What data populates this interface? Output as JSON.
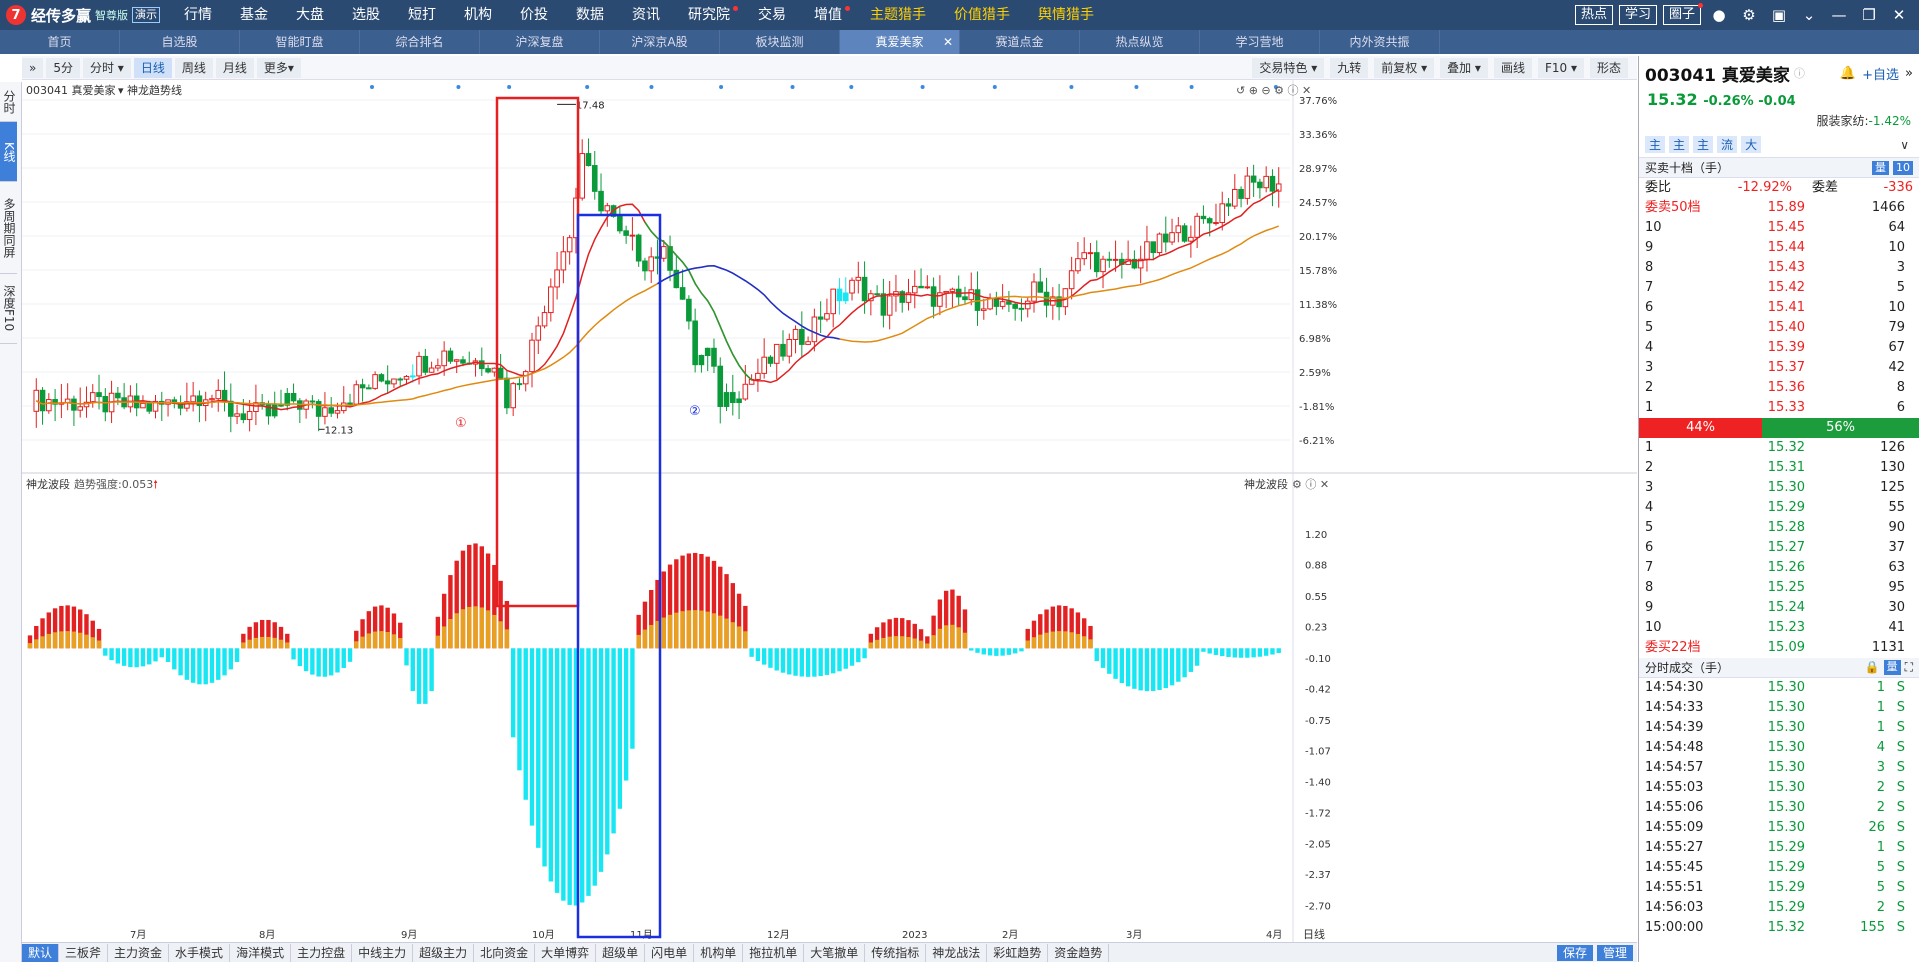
{
  "app": {
    "logo_mark": "7",
    "name": "经传多赢",
    "edition": "智尊版",
    "demo": "演示"
  },
  "topmenu": [
    {
      "label": "行情"
    },
    {
      "label": "基金"
    },
    {
      "label": "大盘"
    },
    {
      "label": "选股"
    },
    {
      "label": "短打"
    },
    {
      "label": "机构"
    },
    {
      "label": "价投"
    },
    {
      "label": "数据"
    },
    {
      "label": "资讯"
    },
    {
      "label": "研究院",
      "dot": true
    },
    {
      "label": "交易"
    },
    {
      "label": "增值",
      "dot": true
    },
    {
      "label": "主题猎手",
      "hl": true
    },
    {
      "label": "价值猎手",
      "hl": true
    },
    {
      "label": "舆情猎手",
      "hl": true
    }
  ],
  "topright": [
    {
      "label": "热点"
    },
    {
      "label": "学习"
    },
    {
      "label": "圈子",
      "dot": true
    }
  ],
  "tabs": [
    {
      "label": "首页"
    },
    {
      "label": "自选股"
    },
    {
      "label": "智能盯盘"
    },
    {
      "label": "综合排名"
    },
    {
      "label": "沪深复盘"
    },
    {
      "label": "沪深京A股"
    },
    {
      "label": "板块监测"
    },
    {
      "label": "真爱美家",
      "active": true
    },
    {
      "label": "赛道点金"
    },
    {
      "label": "热点纵览"
    },
    {
      "label": "学习营地"
    },
    {
      "label": "内外资共振"
    }
  ],
  "leftstrip": [
    {
      "label": "分时"
    },
    {
      "label": "K线",
      "active": true
    },
    {
      "label": "多周期同屏"
    },
    {
      "label": "深度F10"
    }
  ],
  "chart_toolbar": {
    "left": [
      {
        "label": "5分"
      },
      {
        "label": "分时 ▾"
      },
      {
        "label": "日线",
        "active": true
      },
      {
        "label": "周线"
      },
      {
        "label": "月线"
      },
      {
        "label": "更多▾"
      }
    ],
    "right": [
      {
        "label": "交易特色 ▾"
      },
      {
        "label": "九转"
      },
      {
        "label": "前复权 ▾"
      },
      {
        "label": "叠加 ▾"
      },
      {
        "label": "画线"
      },
      {
        "label": "F10 ▾"
      },
      {
        "label": "形态"
      }
    ]
  },
  "chart_header": {
    "stock": "003041 真爱美家",
    "indicator": "神龙趋势线"
  },
  "lower_header": {
    "indicator": "神龙波段",
    "strength": "趋势强度:0.053",
    "right_label": "神龙波段"
  },
  "chart_data": [
    {
      "type": "candlestick",
      "title": "",
      "y_ticks_pct": [
        "37.76%",
        "33.36%",
        "28.97%",
        "24.57%",
        "20.17%",
        "15.78%",
        "11.38%",
        "6.98%",
        "2.59%",
        "-1.81%",
        "-6.21%"
      ],
      "x_ticks": [
        "7月",
        "8月",
        "9月",
        "10月",
        "11月",
        "12月",
        "2023",
        "2月",
        "3月",
        "4月"
      ],
      "annotations": [
        {
          "text": "17.48"
        },
        {
          "text": "12.13"
        },
        {
          "text": "①"
        },
        {
          "text": "②"
        }
      ],
      "series": [
        {
          "name": "",
          "values": []
        }
      ]
    },
    {
      "type": "bar",
      "title": "",
      "y_ticks": [
        "1.20",
        "0.88",
        "0.55",
        "0.23",
        "-0.10",
        "-0.42",
        "-0.75",
        "-1.07",
        "-1.40",
        "-1.72",
        "-2.05",
        "-2.37",
        "-2.70"
      ],
      "ylim": [
        -2.85,
        1.45
      ]
    }
  ],
  "quote": {
    "code_name": "003041 真爱美家",
    "price": "15.32",
    "change": "-0.26% -0.04",
    "industry_label": "服装家纺:",
    "industry_value": "-1.42%",
    "add_watch": "自选"
  },
  "quote_btns": [
    "主",
    "主",
    "主",
    "流",
    "大"
  ],
  "orderbook": {
    "title": "买卖十档（手）",
    "btn1": "量",
    "btn2": "10",
    "ratio_label": "委比",
    "ratio": "-12.92%",
    "diff_label": "委差",
    "diff": "-336",
    "sell50": {
      "label": "委卖50档",
      "price": "15.89",
      "vol": "1466"
    },
    "asks": [
      {
        "lvl": "10",
        "p": "15.45",
        "v": "64"
      },
      {
        "lvl": "9",
        "p": "15.44",
        "v": "10"
      },
      {
        "lvl": "8",
        "p": "15.43",
        "v": "3"
      },
      {
        "lvl": "7",
        "p": "15.42",
        "v": "5"
      },
      {
        "lvl": "6",
        "p": "15.41",
        "v": "10"
      },
      {
        "lvl": "5",
        "p": "15.40",
        "v": "79"
      },
      {
        "lvl": "4",
        "p": "15.39",
        "v": "67"
      },
      {
        "lvl": "3",
        "p": "15.37",
        "v": "42"
      },
      {
        "lvl": "2",
        "p": "15.36",
        "v": "8"
      },
      {
        "lvl": "1",
        "p": "15.33",
        "v": "6"
      }
    ],
    "buy_pct": "44%",
    "sell_pct": "56%",
    "bids": [
      {
        "lvl": "1",
        "p": "15.32",
        "v": "126"
      },
      {
        "lvl": "2",
        "p": "15.31",
        "v": "130"
      },
      {
        "lvl": "3",
        "p": "15.30",
        "v": "125"
      },
      {
        "lvl": "4",
        "p": "15.29",
        "v": "55"
      },
      {
        "lvl": "5",
        "p": "15.28",
        "v": "90"
      },
      {
        "lvl": "6",
        "p": "15.27",
        "v": "37"
      },
      {
        "lvl": "7",
        "p": "15.26",
        "v": "63"
      },
      {
        "lvl": "8",
        "p": "15.25",
        "v": "95"
      },
      {
        "lvl": "9",
        "p": "15.24",
        "v": "30"
      },
      {
        "lvl": "10",
        "p": "15.23",
        "v": "41"
      }
    ],
    "buy22": {
      "label": "委买22档",
      "price": "15.09",
      "vol": "1131"
    }
  },
  "ticks": {
    "title": "分时成交（手）",
    "rows": [
      {
        "t": "14:54:30",
        "p": "15.30",
        "v": "1",
        "s": "S"
      },
      {
        "t": "14:54:33",
        "p": "15.30",
        "v": "1",
        "s": "S"
      },
      {
        "t": "14:54:39",
        "p": "15.30",
        "v": "1",
        "s": "S"
      },
      {
        "t": "14:54:48",
        "p": "15.30",
        "v": "4",
        "s": "S"
      },
      {
        "t": "14:54:57",
        "p": "15.30",
        "v": "3",
        "s": "S"
      },
      {
        "t": "14:55:03",
        "p": "15.30",
        "v": "2",
        "s": "S"
      },
      {
        "t": "14:55:06",
        "p": "15.30",
        "v": "2",
        "s": "S"
      },
      {
        "t": "14:55:09",
        "p": "15.30",
        "v": "26",
        "s": "S"
      },
      {
        "t": "14:55:27",
        "p": "15.29",
        "v": "1",
        "s": "S"
      },
      {
        "t": "14:55:45",
        "p": "15.29",
        "v": "5",
        "s": "S"
      },
      {
        "t": "14:55:51",
        "p": "15.29",
        "v": "5",
        "s": "S"
      },
      {
        "t": "14:56:03",
        "p": "15.29",
        "v": "2",
        "s": "S"
      },
      {
        "t": "15:00:00",
        "p": "15.32",
        "v": "155",
        "s": "S"
      }
    ]
  },
  "bottom_tabs": [
    {
      "label": "默认",
      "active": true
    },
    {
      "label": "三板斧"
    },
    {
      "label": "主力资金"
    },
    {
      "label": "水手模式"
    },
    {
      "label": "海洋模式"
    },
    {
      "label": "主力控盘"
    },
    {
      "label": "中线主力"
    },
    {
      "label": "超级主力"
    },
    {
      "label": "北向资金"
    },
    {
      "label": "大单博弈"
    },
    {
      "label": "超级单"
    },
    {
      "label": "闪电单"
    },
    {
      "label": "机构单"
    },
    {
      "label": "拖拉机单"
    },
    {
      "label": "大笔撤单"
    },
    {
      "label": "传统指标"
    },
    {
      "label": "神龙战法"
    },
    {
      "label": "彩虹趋势"
    },
    {
      "label": "资金趋势"
    }
  ],
  "bottom_right": {
    "save": "保存",
    "manage": "管理",
    "period": "日线"
  },
  "colors": {
    "up": "#e22222",
    "down": "#0a9a3a",
    "cyan": "#18e6f2",
    "ma_red": "#e02020",
    "ma_orange": "#e08a10",
    "ma_green": "#20a030",
    "ma_blue": "#1a2fd6",
    "box1": "#e62020",
    "box2": "#1a2fe0"
  }
}
